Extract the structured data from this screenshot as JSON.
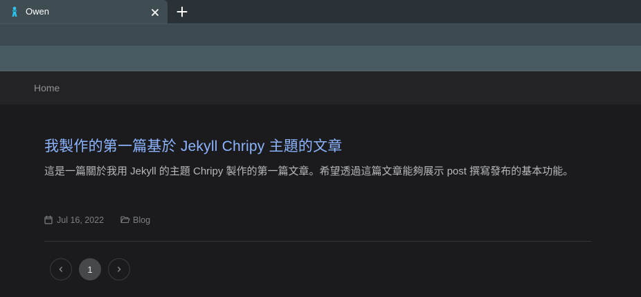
{
  "browser": {
    "tab_title": "Owen",
    "favicon": "owen-figure-icon",
    "close_icon": "close-icon",
    "new_tab_icon": "plus-icon"
  },
  "topbar": {
    "breadcrumb_home": "Home"
  },
  "post": {
    "title": "我製作的第一篇基於 Jekyll Chripy 主題的文章",
    "excerpt": "這是一篇關於我用 Jekyll 的主題 Chripy 製作的第一篇文章。希望透過這篇文章能夠展示 post 撰寫發布的基本功能。",
    "date": "Jul 16, 2022",
    "category": "Blog",
    "date_icon": "calendar-icon",
    "category_icon": "folder-open-icon"
  },
  "pagination": {
    "prev_icon": "chevron-left-icon",
    "current_page": "1",
    "next_icon": "chevron-right-icon"
  },
  "colors": {
    "link": "#8cb4ff",
    "page_bg": "#1b1b1e",
    "tab_active": "#3f4d53"
  }
}
